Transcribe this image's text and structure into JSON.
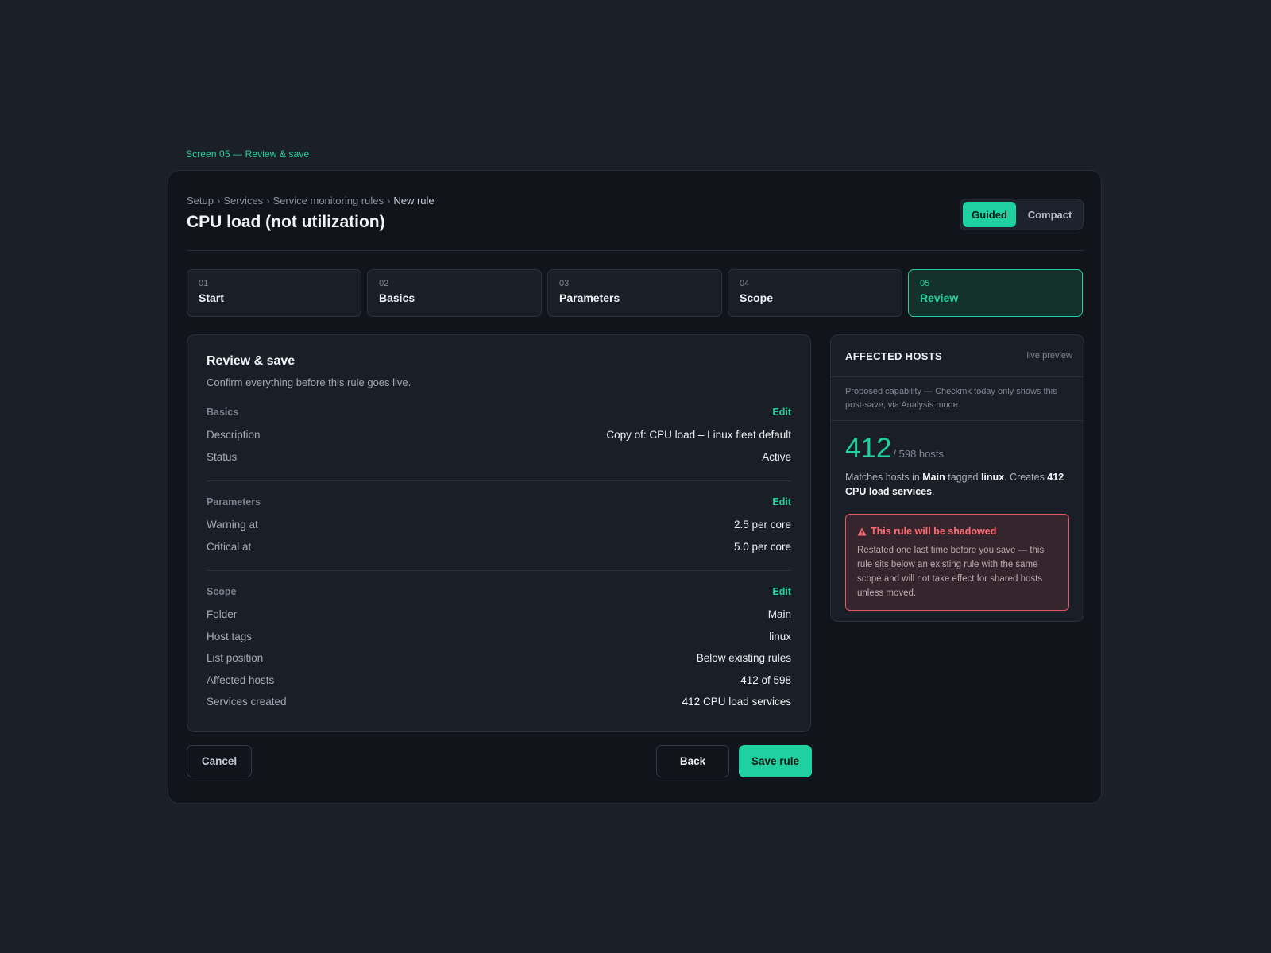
{
  "screen_label": "Screen 05 — Review & save",
  "breadcrumb": {
    "items": [
      "Setup",
      "Services",
      "Service monitoring rules"
    ],
    "current": "New rule",
    "separator": "›"
  },
  "page_title": "CPU load (not utilization)",
  "mode_toggle": {
    "guided": "Guided",
    "compact": "Compact",
    "selected": "Guided"
  },
  "steps": [
    {
      "num": "01",
      "label": "Start"
    },
    {
      "num": "02",
      "label": "Basics"
    },
    {
      "num": "03",
      "label": "Parameters"
    },
    {
      "num": "04",
      "label": "Scope"
    },
    {
      "num": "05",
      "label": "Review"
    }
  ],
  "review": {
    "title": "Review & save",
    "subtitle": "Confirm everything before this rule goes live.",
    "edit_label": "Edit",
    "sections": [
      {
        "name": "Basics",
        "rows": [
          {
            "key": "Description",
            "value": "Copy of: CPU load – Linux fleet default"
          },
          {
            "key": "Status",
            "value": "Active"
          }
        ]
      },
      {
        "name": "Parameters",
        "rows": [
          {
            "key": "Warning at",
            "value": "2.5 per core"
          },
          {
            "key": "Critical at",
            "value": "5.0 per core"
          }
        ]
      },
      {
        "name": "Scope",
        "rows": [
          {
            "key": "Folder",
            "value": "Main"
          },
          {
            "key": "Host tags",
            "value": "linux"
          },
          {
            "key": "List position",
            "value": "Below existing rules"
          },
          {
            "key": "Affected hosts",
            "value": "412 of 598"
          },
          {
            "key": "Services created",
            "value": "412 CPU load services"
          }
        ]
      }
    ]
  },
  "actions": {
    "cancel": "Cancel",
    "back": "Back",
    "save": "Save rule"
  },
  "affected_hosts": {
    "title": "AFFECTED HOSTS",
    "badge": "live preview",
    "note": "Proposed capability — Checkmk today only shows this post-save, via Analysis mode.",
    "count": "412",
    "total": "/ 598 hosts",
    "match": {
      "p1": "Matches hosts in ",
      "folder": "Main",
      "p2": " tagged ",
      "tag": "linux",
      "p3": ". Creates ",
      "services": "412 CPU load services",
      "p4": "."
    },
    "warning": {
      "title": "This rule will be shadowed",
      "text": "Restated one last time before you save — this rule sits below an existing rule with the same scope and will not take effect for shared hosts unless moved."
    }
  },
  "colors": {
    "accent": "#1fd1a0",
    "danger": "#ff6b72",
    "background": "#1a1f28",
    "panel": "#11151b"
  }
}
